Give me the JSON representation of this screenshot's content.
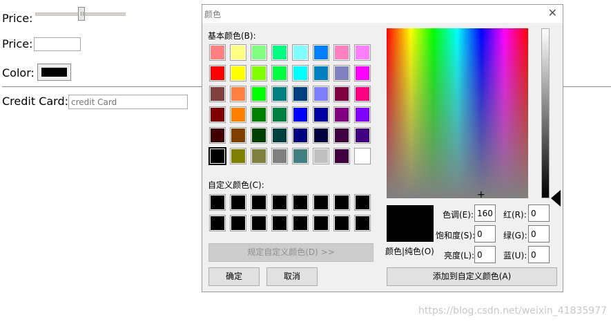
{
  "form": {
    "price_label_1": "Price:",
    "price_slider_value": 0.5,
    "price_label_2": "Price:",
    "price_value": "",
    "color_label": "Color:",
    "color_value": "#000000",
    "cc_label": "Credit Card:",
    "cc_placeholder": "credit Card"
  },
  "dialog": {
    "title": "颜色",
    "close_glyph": "✕",
    "basic_colors_label": "基本颜色(B):",
    "basic_colors": [
      "#ff8080",
      "#ffff80",
      "#80ff80",
      "#00ff80",
      "#80ffff",
      "#0080ff",
      "#ff80c0",
      "#ff80ff",
      "#ff0000",
      "#ffff00",
      "#80ff00",
      "#00ff40",
      "#00ffff",
      "#0080c0",
      "#8080c0",
      "#ff00ff",
      "#804040",
      "#ff8040",
      "#00ff00",
      "#008080",
      "#004080",
      "#8080ff",
      "#800040",
      "#ff0080",
      "#800000",
      "#ff8000",
      "#008000",
      "#008040",
      "#0000ff",
      "#0000a0",
      "#800080",
      "#8000ff",
      "#400000",
      "#804000",
      "#004000",
      "#004040",
      "#000080",
      "#000040",
      "#400040",
      "#400080",
      "#000000",
      "#808000",
      "#808040",
      "#808080",
      "#408080",
      "#c0c0c0",
      "#400040",
      "#ffffff"
    ],
    "selected_basic_index": 40,
    "custom_colors_label": "自定义颜色(C):",
    "custom_colors": [
      "#000000",
      "#000000",
      "#000000",
      "#000000",
      "#000000",
      "#000000",
      "#000000",
      "#000000",
      "#000000",
      "#000000",
      "#000000",
      "#000000",
      "#000000",
      "#000000",
      "#000000",
      "#000000"
    ],
    "define_custom_button": "规定自定义颜色(D) >>",
    "ok_button": "确定",
    "cancel_button": "取消",
    "crosshair_glyph": "+",
    "preview_label": "颜色|纯色(O)",
    "preview_color": "#000000",
    "hue_label": "色调(E):",
    "hue_value": "160",
    "sat_label": "饱和度(S):",
    "sat_value": "0",
    "lum_label": "亮度(L):",
    "lum_value": "0",
    "red_label": "红(R):",
    "red_value": "0",
    "green_label": "绿(G):",
    "green_value": "0",
    "blue_label": "蓝(U):",
    "blue_value": "0",
    "add_custom_button": "添加到自定义颜色(A)"
  },
  "watermark": "https://blog.csdn.net/weixin_41835977"
}
